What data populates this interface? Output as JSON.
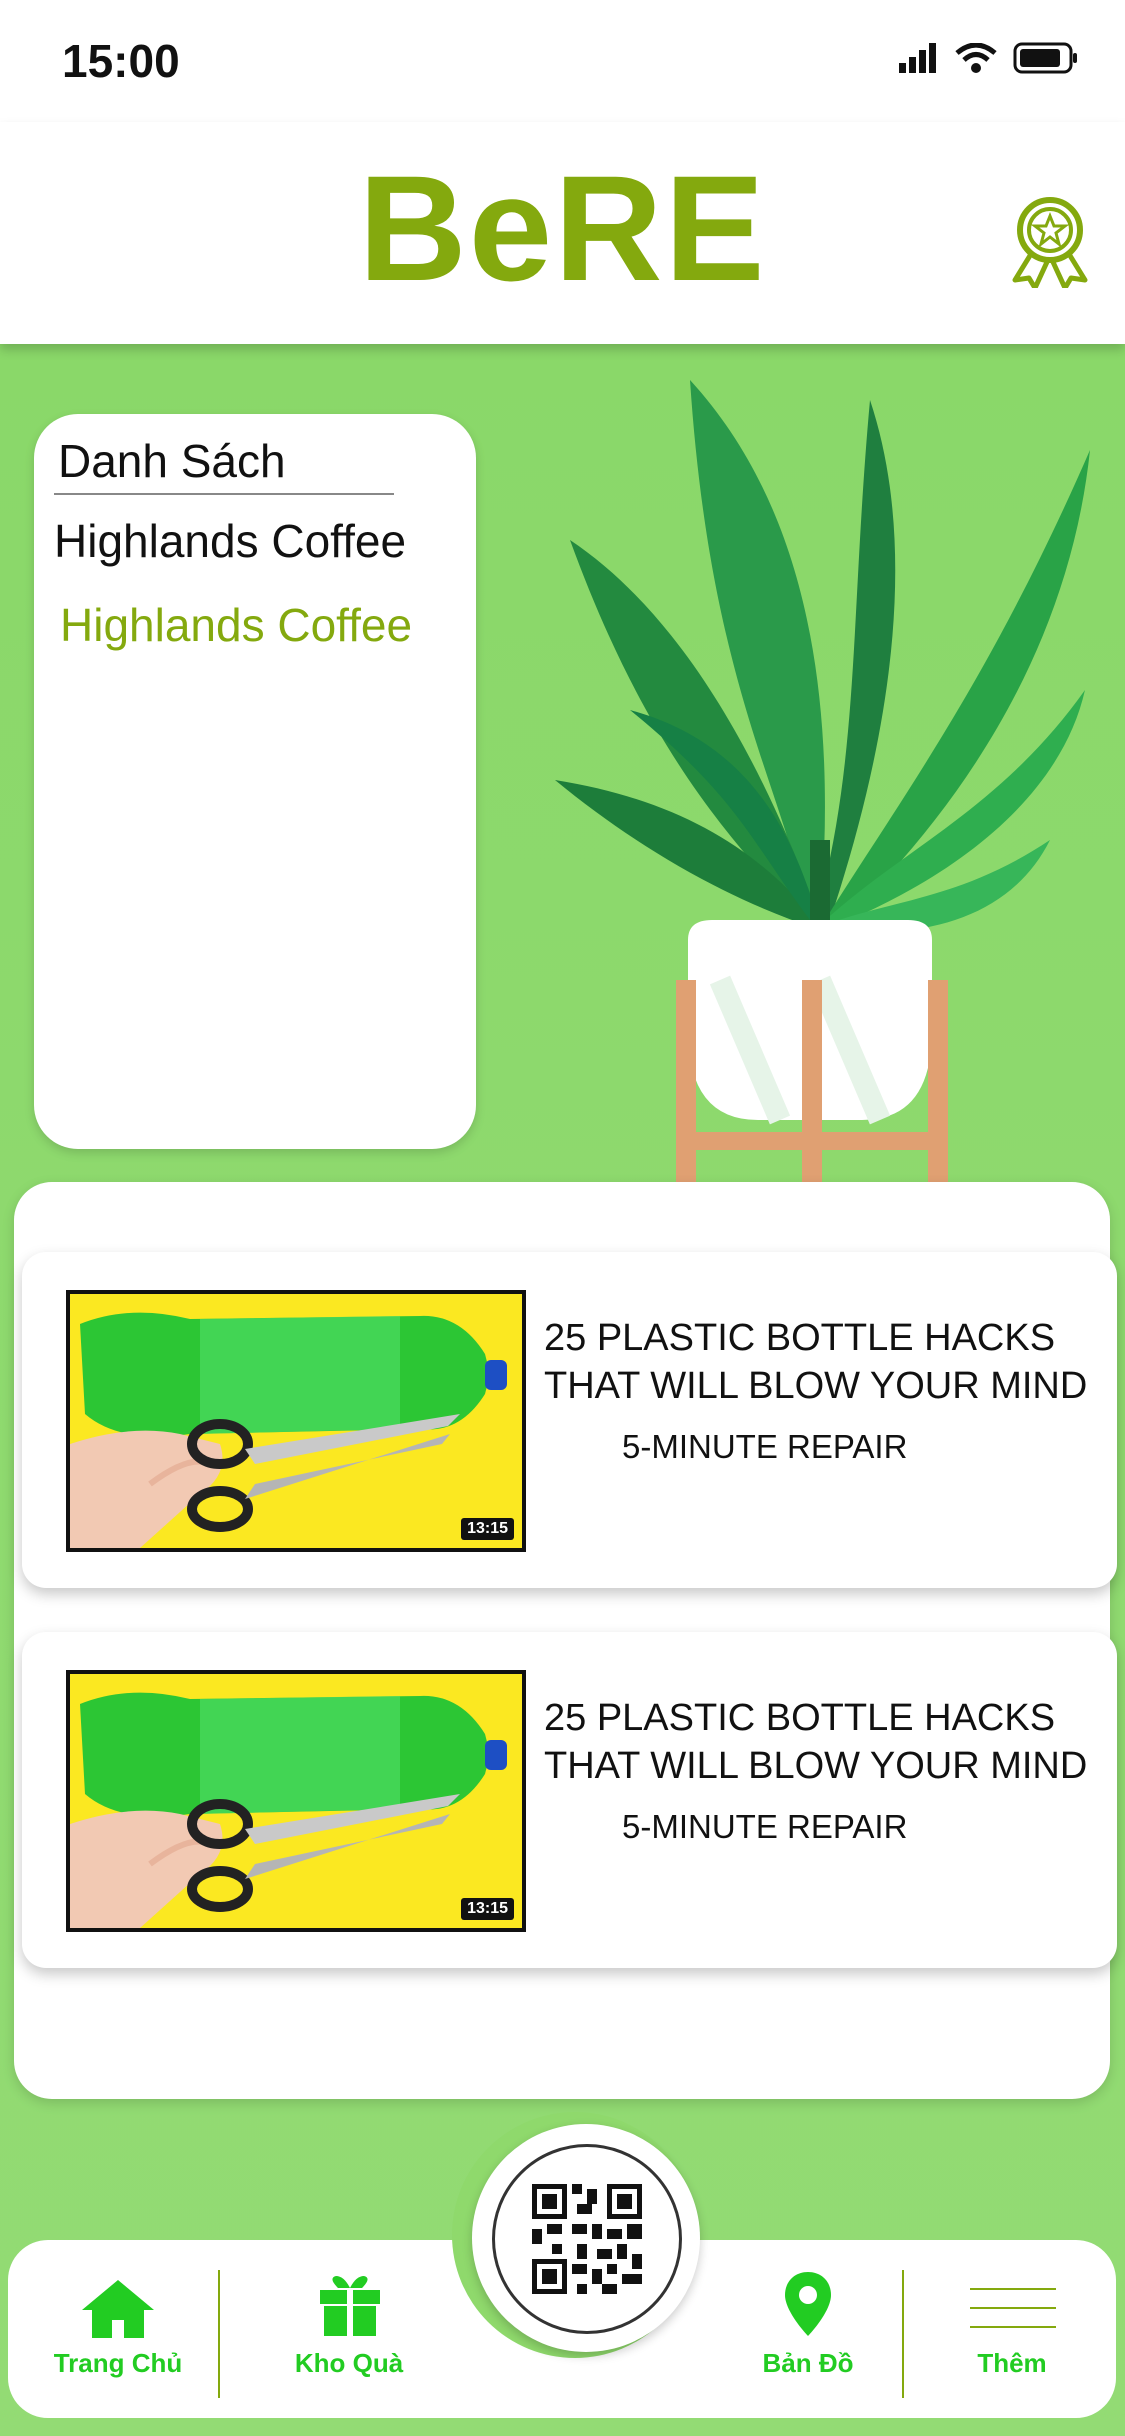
{
  "status_bar": {
    "time": "15:00"
  },
  "header": {
    "logo": "BeRE"
  },
  "list_card": {
    "title": "Danh Sách",
    "items": [
      "Highlands Coffee",
      "Highlands Coffee"
    ]
  },
  "feed": {
    "videos": [
      {
        "title": "25 PLASTIC BOTTLE HACKS THAT WILL BLOW YOUR MIND",
        "channel": "5-MINUTE REPAIR",
        "duration": "13:15"
      },
      {
        "title": "25 PLASTIC BOTTLE HACKS THAT WILL BLOW YOUR MIND",
        "channel": "5-MINUTE REPAIR",
        "duration": "13:15"
      }
    ]
  },
  "tabbar": {
    "home": "Trang Chủ",
    "gifts": "Kho Quà",
    "map": "Bản Đồ",
    "more": "Thêm"
  },
  "colors": {
    "brand": "#84a90e",
    "tab_accent": "#22cc22",
    "background": "#8fd96c"
  }
}
